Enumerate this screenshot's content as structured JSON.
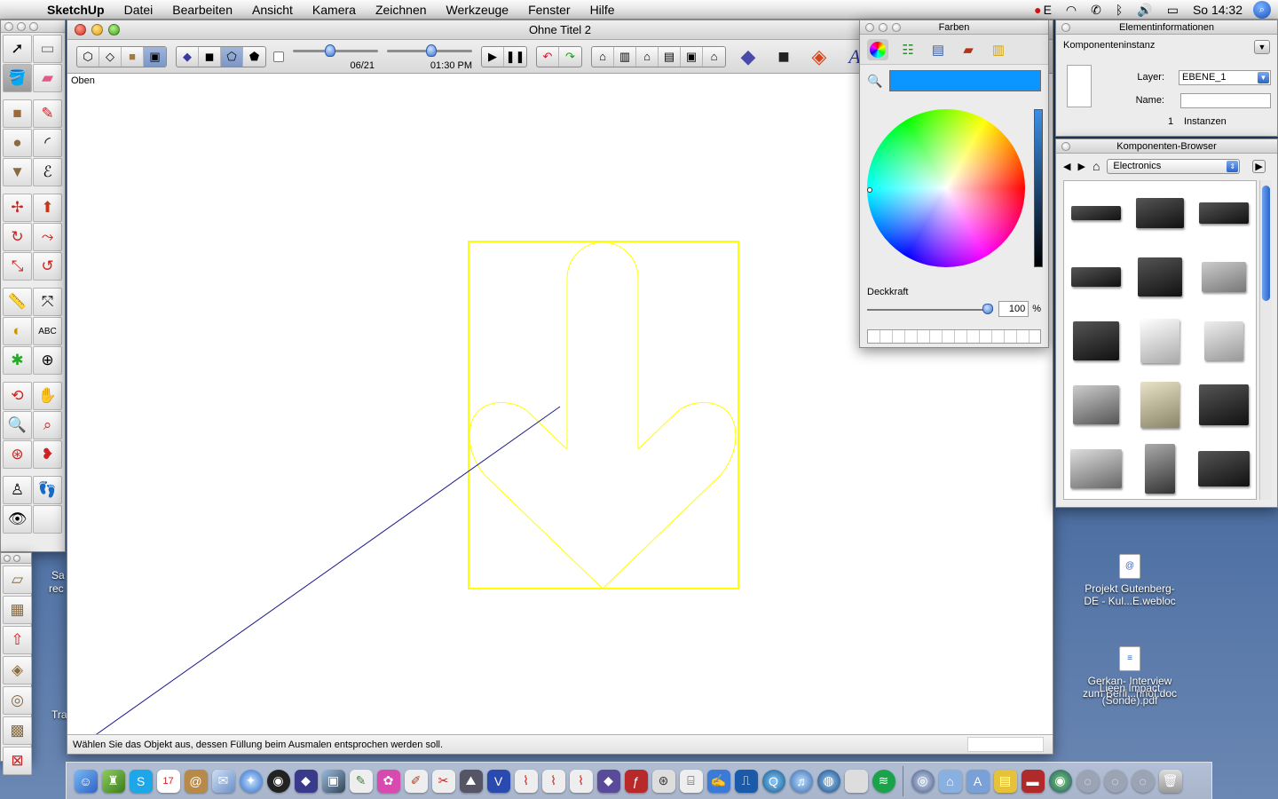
{
  "menubar": {
    "app_name": "SketchUp",
    "items": [
      "Datei",
      "Bearbeiten",
      "Ansicht",
      "Kamera",
      "Zeichnen",
      "Werkzeuge",
      "Fenster",
      "Hilfe"
    ],
    "input_indicator": "E",
    "clock": "So 14:32"
  },
  "main_window": {
    "title": "Ohne Titel 2",
    "shadow_date": "06/21",
    "shadow_time": "01:30 PM",
    "view_label": "Oben",
    "status_text": "Wählen Sie das Objekt aus, dessen Füllung beim Ausmalen entsprochen werden soll.",
    "drawing_color": "#ffff00",
    "line_color": "#1a1a8c"
  },
  "colors_panel": {
    "title": "Farben",
    "current_color": "#0a95ff",
    "opacity_label": "Deckkraft",
    "opacity_value": "100",
    "opacity_unit": "%"
  },
  "entity_info": {
    "title": "Elementinformationen",
    "entity_type": "Komponenteninstanz",
    "layer_label": "Layer:",
    "layer_value": "EBENE_1",
    "name_label": "Name:",
    "name_value": "",
    "instances_count": "1",
    "instances_label": "Instanzen"
  },
  "components_browser": {
    "title": "Komponenten-Browser",
    "collection": "Electronics",
    "items": [
      "vcr",
      "stereo",
      "dvd-player",
      "dvd-recorder",
      "computer-monitor",
      "old-monitor",
      "tower-pc",
      "imac",
      "crt-monitor",
      "desktop-pc",
      "retro-pc",
      "laptop",
      "laptop-open",
      "server-tower",
      "telephone"
    ]
  },
  "desktop": {
    "icon1_line1": "Projekt Gutenberg-",
    "icon1_line2": "DE - Kul...E.webloc",
    "icon2_line1": "Gerkan- Interview",
    "icon2_line2": "zum Berli...hnof.doc",
    "icon3_line1": "Lieen Impact",
    "icon3_line2": "(Sonde).pdf",
    "partial1": "Sa",
    "partial2": "rec",
    "partial3": "Tra"
  },
  "dock": {
    "icons": [
      "finder",
      "automator",
      "skype",
      "ical",
      "address-book",
      "mail",
      "safari",
      "dvd-player",
      "vectorworks",
      "iphoto",
      "textedit",
      "flower-app",
      "sketchup",
      "tools",
      "terminal",
      "vectorworks-v",
      "acrobat",
      "acrobat2",
      "acrobat3",
      "cube-app",
      "flash-app",
      "network",
      "preview",
      "pages",
      "keynote",
      "quicktime",
      "itunes",
      "safari-globe",
      "finder-mac",
      "spotify",
      "network-globe",
      "home",
      "applications",
      "documents",
      "library",
      "globe",
      "system-disk1",
      "system-disk2",
      "system-disk3",
      "trash"
    ]
  }
}
